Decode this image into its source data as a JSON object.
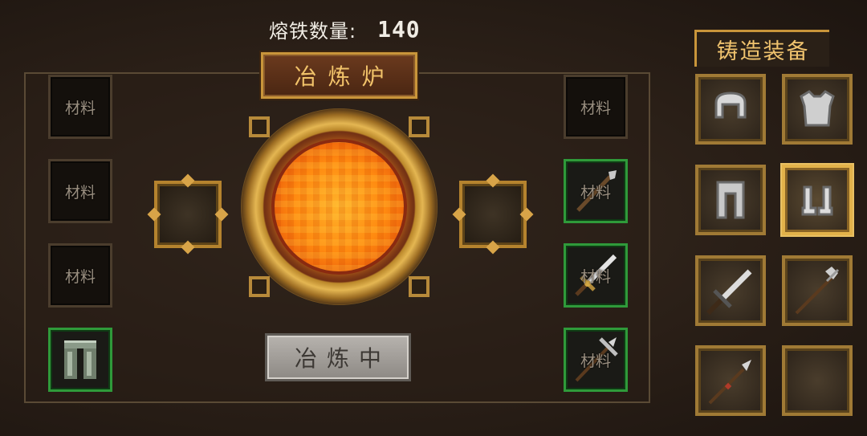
{
  "header": {
    "iron_label": "熔铁数量:",
    "iron_count": "140"
  },
  "furnace": {
    "title": "冶炼炉",
    "action_button": "冶炼中",
    "left_slots": [
      {
        "label": "材料",
        "active": false
      },
      {
        "label": "材料",
        "active": false
      },
      {
        "label": "材料",
        "active": false
      },
      {
        "label": "",
        "icon": "armor-pants-icon",
        "active": true
      }
    ],
    "right_slots": [
      {
        "label": "材料",
        "icon": "",
        "active": false
      },
      {
        "label": "材料",
        "icon": "spear-icon",
        "active": true
      },
      {
        "label": "材料",
        "icon": "sword-icon",
        "active": true
      },
      {
        "label": "材料",
        "icon": "halberd-icon",
        "active": true
      }
    ]
  },
  "equipment": {
    "title": "铸造装备",
    "items": [
      {
        "icon": "helmet-icon"
      },
      {
        "icon": "chestplate-icon"
      },
      {
        "icon": "leggings-icon"
      },
      {
        "icon": "boots-icon",
        "selected": true
      },
      {
        "icon": "sword-icon"
      },
      {
        "icon": "halberd-icon"
      },
      {
        "icon": "spear-icon"
      },
      {
        "icon": "empty"
      }
    ]
  },
  "colors": {
    "accent_gold": "#c9953a",
    "active_green": "#2f9a3a",
    "molten": "#ff8a10"
  }
}
